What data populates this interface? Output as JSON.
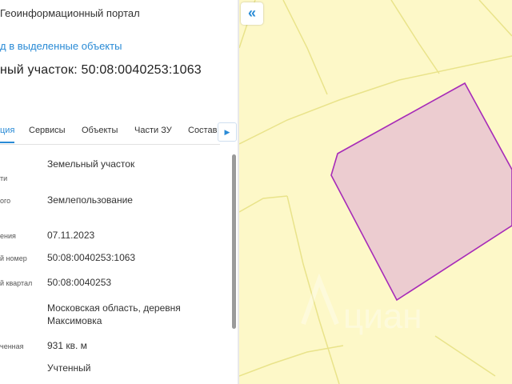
{
  "header": {
    "portal_title": "Геоинформационный портал"
  },
  "nav": {
    "back_link": "д в выделенные объекты"
  },
  "parcel": {
    "title": "ный участок: 50:08:0040253:1063"
  },
  "tabs": [
    {
      "label": "ция",
      "active": true
    },
    {
      "label": "Сервисы",
      "active": false
    },
    {
      "label": "Объекты",
      "active": false
    },
    {
      "label": "Части ЗУ",
      "active": false
    },
    {
      "label": "Состав",
      "active": false
    }
  ],
  "tabs_next_icon": "chevron-right-icon",
  "details": {
    "rows": [
      {
        "label": "ти",
        "value": "Земельный участок"
      },
      {
        "label": "ого",
        "value": "Землепользование"
      },
      {
        "label": "ения",
        "value": "07.11.2023"
      },
      {
        "label": "й номер",
        "value": "50:08:0040253:1063"
      },
      {
        "label": "й квартал",
        "value": "50:08:0040253"
      },
      {
        "label": "",
        "value": "Московская область, деревня Максимовка"
      },
      {
        "label": "ченная",
        "value": "931 кв. м"
      },
      {
        "label": "",
        "value": "Учтенный"
      }
    ]
  },
  "map": {
    "collapse_icon": "double-chevron-left-icon",
    "collapse_glyph": "«",
    "background_color": "#fdf8c8",
    "boundary_color": "#e9e38a",
    "parcel_fill": "#ecccd0",
    "parcel_stroke": "#a72bb8",
    "watermark_text": "циан"
  }
}
